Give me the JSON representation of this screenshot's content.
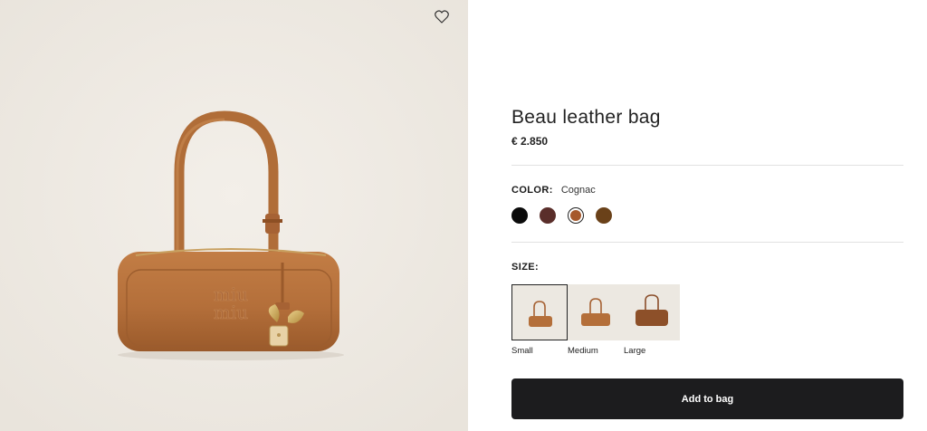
{
  "product": {
    "title": "Beau leather bag",
    "price": "€ 2.850",
    "image": {
      "icon": "bag-photo",
      "background": "#efebe5",
      "bag_color": "#b8743f"
    }
  },
  "favorite": {
    "icon": "heart-icon"
  },
  "color": {
    "label": "COLOR:",
    "selected": "Cognac",
    "swatches": [
      {
        "hex": "#0b0b0b",
        "selected": false
      },
      {
        "hex": "#5a2e2a",
        "selected": false
      },
      {
        "hex": "#a6592c",
        "selected": true
      },
      {
        "hex": "#6a4119",
        "selected": false
      }
    ]
  },
  "size": {
    "label": "SIZE:",
    "options": [
      {
        "name": "Small",
        "selected": true
      },
      {
        "name": "Medium",
        "selected": false
      },
      {
        "name": "Large",
        "selected": false
      }
    ]
  },
  "cta": {
    "add_to_bag": "Add to bag"
  }
}
